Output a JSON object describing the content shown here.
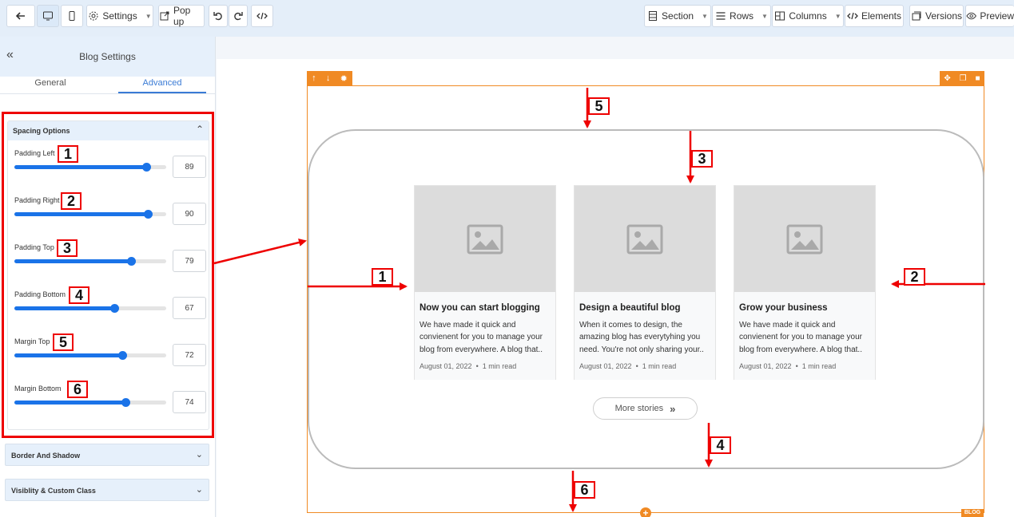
{
  "toolbar": {
    "settings_label": "Settings",
    "popup_label": "Pop up",
    "section_label": "Section",
    "rows_label": "Rows",
    "columns_label": "Columns",
    "elements_label": "Elements",
    "versions_label": "Versions",
    "preview_label": "Preview"
  },
  "panel": {
    "title": "Blog Settings",
    "tabs": [
      "General",
      "Advanced"
    ],
    "active_tab": "Advanced",
    "spacing": {
      "heading": "Spacing Options",
      "options": [
        {
          "label": "Padding Left",
          "value": "89",
          "number": "1",
          "fill_percent": 87
        },
        {
          "label": "Padding Right",
          "value": "90",
          "number": "2",
          "fill_percent": 88
        },
        {
          "label": "Padding Top",
          "value": "79",
          "number": "3",
          "fill_percent": 77
        },
        {
          "label": "Padding Bottom",
          "value": "67",
          "number": "4",
          "fill_percent": 66
        },
        {
          "label": "Margin Top",
          "value": "72",
          "number": "5",
          "fill_percent": 71
        },
        {
          "label": "Margin Bottom",
          "value": "74",
          "number": "6",
          "fill_percent": 73
        }
      ]
    },
    "accordions": [
      "Border And Shadow",
      "Visiblity & Custom Class"
    ]
  },
  "canvas": {
    "cards": [
      {
        "title": "Now you can start blogging",
        "desc": "We have made it quick and convienent for you to manage your blog from everywhere. A blog that..",
        "date": "August 01, 2022",
        "read": "1 min read"
      },
      {
        "title": "Design a beautiful blog",
        "desc": "When it comes to design, the amazing blog has everytyhing you need. You're not only sharing your..",
        "date": "August 01, 2022",
        "read": "1 min read"
      },
      {
        "title": "Grow your business",
        "desc": "We have made it quick and convienent for you to manage your blog from everywhere. A blog that..",
        "date": "August 01, 2022",
        "read": "1 min read"
      }
    ],
    "more_label": "More stories",
    "blog_tag": "BLOG",
    "annotations": [
      "1",
      "2",
      "3",
      "4",
      "5",
      "6"
    ]
  },
  "colors": {
    "accent": "#1a73e8",
    "section_border": "#f08a24",
    "annotation": "#e00000"
  }
}
